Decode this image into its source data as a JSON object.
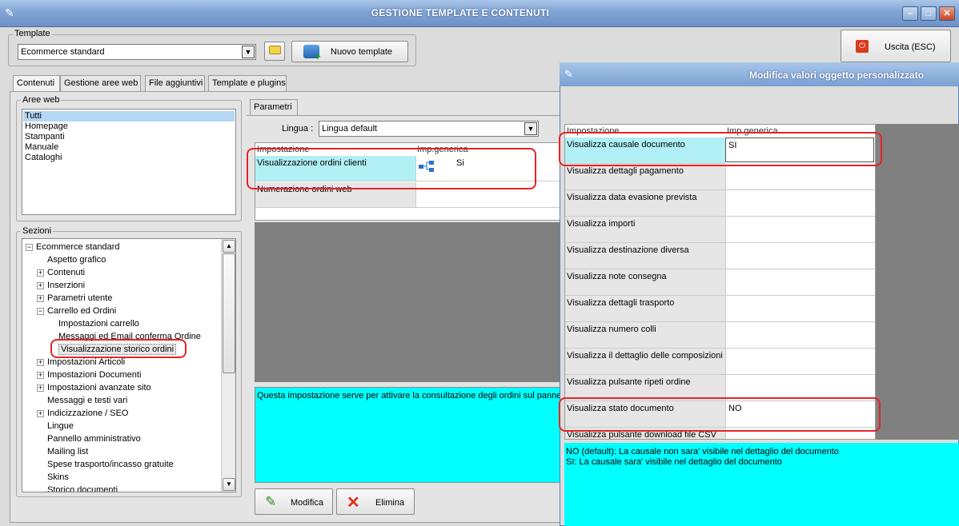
{
  "window": {
    "title": "GESTIONE TEMPLATE E CONTENUTI"
  },
  "template": {
    "label": "Template",
    "value": "Ecommerce standard",
    "new_button": "Nuovo template"
  },
  "exit_button": "Uscita (ESC)",
  "tabs": [
    "Contenuti",
    "Gestione aree web",
    "File aggiuntivi",
    "Template e plugins"
  ],
  "aree_web": {
    "label": "Aree web",
    "items": [
      "Tutti",
      "Homepage",
      "Stampanti",
      "Manuale",
      "Cataloghi"
    ]
  },
  "sezioni": {
    "label": "Sezioni",
    "tree": [
      {
        "label": "Ecommerce standard",
        "level": 0,
        "exp": "−"
      },
      {
        "label": "Aspetto grafico",
        "level": 1,
        "exp": ""
      },
      {
        "label": "Contenuti",
        "level": 1,
        "exp": "+"
      },
      {
        "label": "Inserzioni",
        "level": 1,
        "exp": "+"
      },
      {
        "label": "Parametri utente",
        "level": 1,
        "exp": "+"
      },
      {
        "label": "Carrello ed Ordini",
        "level": 1,
        "exp": "−"
      },
      {
        "label": "Impostazioni carrello",
        "level": 2,
        "exp": ""
      },
      {
        "label": "Messaggi ed Email conferma Ordine",
        "level": 2,
        "exp": ""
      },
      {
        "label": "Visualizzazione storico ordini",
        "level": 2,
        "exp": "",
        "selected": true
      },
      {
        "label": "Impostazioni Articoli",
        "level": 1,
        "exp": "+"
      },
      {
        "label": "Impostazioni Documenti",
        "level": 1,
        "exp": "+"
      },
      {
        "label": "Impostazioni avanzate sito",
        "level": 1,
        "exp": "+"
      },
      {
        "label": "Messaggi e testi vari",
        "level": 1,
        "exp": ""
      },
      {
        "label": "Indicizzazione / SEO",
        "level": 1,
        "exp": "+"
      },
      {
        "label": "Lingue",
        "level": 1,
        "exp": ""
      },
      {
        "label": "Pannello amministrativo",
        "level": 1,
        "exp": ""
      },
      {
        "label": "Mailing list",
        "level": 1,
        "exp": ""
      },
      {
        "label": "Spese trasporto/incasso gratuite",
        "level": 1,
        "exp": ""
      },
      {
        "label": "Skins",
        "level": 1,
        "exp": ""
      },
      {
        "label": "Storico documenti",
        "level": 1,
        "exp": ""
      }
    ]
  },
  "parametri": {
    "tab": "Parametri",
    "lingua_label": "Lingua :",
    "lingua_value": "Lingua default",
    "col1": "Impostazione",
    "col2": "Imp.generica",
    "rows": [
      {
        "name": "Visualizzazione ordini clienti",
        "value": "Si"
      },
      {
        "name": "Numerazione ordini web",
        "value": ""
      }
    ],
    "description": "Questa impostazione serve per attivare la consultazione degli ordini sul pannell",
    "modifica": "Modifica",
    "elimina": "Elimina"
  },
  "dialog": {
    "title": "Modifica valori oggetto personalizzato",
    "col1": "Impostazione",
    "col2": "Imp.generica",
    "rows": [
      {
        "name": "Visualizza causale documento",
        "value": "SI"
      },
      {
        "name": "Visualizza dettagli pagamento",
        "value": ""
      },
      {
        "name": "Visualizza data evasione prevista",
        "value": ""
      },
      {
        "name": "Visualizza importi",
        "value": ""
      },
      {
        "name": "Visualizza destinazione diversa",
        "value": ""
      },
      {
        "name": "Visualizza note consegna",
        "value": ""
      },
      {
        "name": "Visualizza dettagli trasporto",
        "value": ""
      },
      {
        "name": "Visualizza numero colli",
        "value": ""
      },
      {
        "name": "Visualizza il dettaglio delle composizioni",
        "value": ""
      },
      {
        "name": "Visualizza pulsante ripeti ordine",
        "value": ""
      },
      {
        "name": "Visualizza stato documento",
        "value": "NO"
      },
      {
        "name": "Visualizza pulsante download file CSV",
        "value": ""
      }
    ],
    "help_line1": "NO (default): La causale non sara' visibile nel dettaglio del documento",
    "help_line2": "SI: La causale sara' visibile nel dettaglio del documento"
  }
}
